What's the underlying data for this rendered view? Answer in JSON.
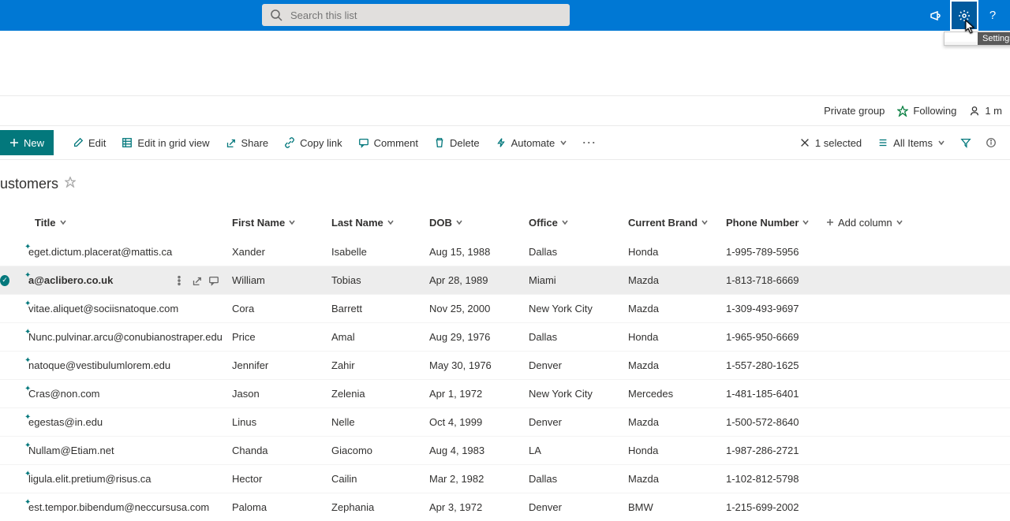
{
  "search": {
    "placeholder": "Search this list"
  },
  "tooltip": "Settings",
  "info": {
    "group": "Private group",
    "following": "Following",
    "members": "1 m"
  },
  "commands": {
    "new": "New",
    "edit": "Edit",
    "editgrid": "Edit in grid view",
    "share": "Share",
    "copylink": "Copy link",
    "comment": "Comment",
    "delete": "Delete",
    "automate": "Automate",
    "selected": "1 selected",
    "view": "All Items"
  },
  "list_title": "ustomers",
  "columns": {
    "title": "Title",
    "first_name": "First Name",
    "last_name": "Last Name",
    "dob": "DOB",
    "office": "Office",
    "brand": "Current Brand",
    "phone": "Phone Number",
    "add": "Add column"
  },
  "rows": [
    {
      "title": "eget.dictum.placerat@mattis.ca",
      "first_name": "Xander",
      "last_name": "Isabelle",
      "dob": "Aug 15, 1988",
      "office": "Dallas",
      "brand": "Honda",
      "phone": "1-995-789-5956",
      "selected": false
    },
    {
      "title": "a@aclibero.co.uk",
      "first_name": "William",
      "last_name": "Tobias",
      "dob": "Apr 28, 1989",
      "office": "Miami",
      "brand": "Mazda",
      "phone": "1-813-718-6669",
      "selected": true
    },
    {
      "title": "vitae.aliquet@sociisnatoque.com",
      "first_name": "Cora",
      "last_name": "Barrett",
      "dob": "Nov 25, 2000",
      "office": "New York City",
      "brand": "Mazda",
      "phone": "1-309-493-9697",
      "selected": false
    },
    {
      "title": "Nunc.pulvinar.arcu@conubianostraper.edu",
      "first_name": "Price",
      "last_name": "Amal",
      "dob": "Aug 29, 1976",
      "office": "Dallas",
      "brand": "Honda",
      "phone": "1-965-950-6669",
      "selected": false
    },
    {
      "title": "natoque@vestibulumlorem.edu",
      "first_name": "Jennifer",
      "last_name": "Zahir",
      "dob": "May 30, 1976",
      "office": "Denver",
      "brand": "Mazda",
      "phone": "1-557-280-1625",
      "selected": false
    },
    {
      "title": "Cras@non.com",
      "first_name": "Jason",
      "last_name": "Zelenia",
      "dob": "Apr 1, 1972",
      "office": "New York City",
      "brand": "Mercedes",
      "phone": "1-481-185-6401",
      "selected": false
    },
    {
      "title": "egestas@in.edu",
      "first_name": "Linus",
      "last_name": "Nelle",
      "dob": "Oct 4, 1999",
      "office": "Denver",
      "brand": "Mazda",
      "phone": "1-500-572-8640",
      "selected": false
    },
    {
      "title": "Nullam@Etiam.net",
      "first_name": "Chanda",
      "last_name": "Giacomo",
      "dob": "Aug 4, 1983",
      "office": "LA",
      "brand": "Honda",
      "phone": "1-987-286-2721",
      "selected": false
    },
    {
      "title": "ligula.elit.pretium@risus.ca",
      "first_name": "Hector",
      "last_name": "Cailin",
      "dob": "Mar 2, 1982",
      "office": "Dallas",
      "brand": "Mazda",
      "phone": "1-102-812-5798",
      "selected": false
    },
    {
      "title": "est.tempor.bibendum@neccursusa.com",
      "first_name": "Paloma",
      "last_name": "Zephania",
      "dob": "Apr 3, 1972",
      "office": "Denver",
      "brand": "BMW",
      "phone": "1-215-699-2002",
      "selected": false
    }
  ]
}
